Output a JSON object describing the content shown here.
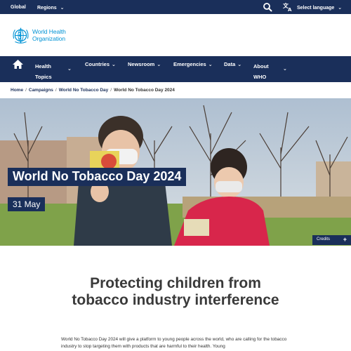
{
  "topbar": {
    "global_label": "Global",
    "regions_label": "Regions",
    "language_label": "Select language"
  },
  "logo": {
    "line1": "World Health",
    "line2": "Organization"
  },
  "nav": {
    "health_topics_line1": "Health",
    "health_topics_line2": "Topics",
    "countries": "Countries",
    "newsroom": "Newsroom",
    "emergencies": "Emergencies",
    "data": "Data",
    "about_line1": "About",
    "about_line2": "WHO"
  },
  "breadcrumb": {
    "home": "Home",
    "campaigns": "Campaigns",
    "event": "World No Tobacco Day",
    "current": "World No Tobacco Day 2024"
  },
  "hero": {
    "title": "World No Tobacco Day 2024",
    "date": "31 May",
    "credits_label": "Credits"
  },
  "heading": {
    "line1": "Protecting children from",
    "line2": "tobacco industry interference"
  },
  "intro": "World No Tobacco Day 2024 will give a platform to young people across the world, who are calling for the tobacco industry to stop targeting them with products that are harmful to their health. Young",
  "colors": {
    "navy": "#1a2f5a",
    "who_blue": "#0093d5"
  }
}
